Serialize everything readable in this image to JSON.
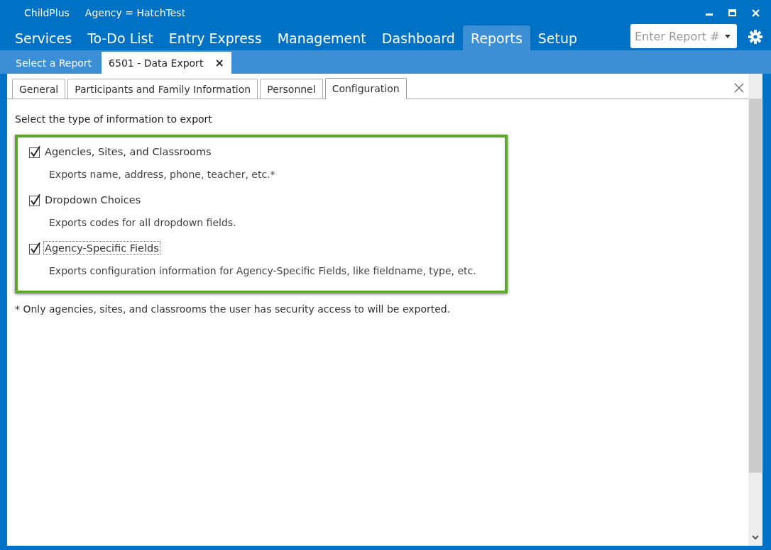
{
  "window": {
    "app_name": "ChildPlus",
    "agency": "Agency = HatchTest",
    "controls": [
      {
        "kind": "minimize"
      },
      {
        "kind": "maximize"
      },
      {
        "kind": "close"
      }
    ]
  },
  "menu": [
    {
      "label": "Services",
      "selected": false
    },
    {
      "label": "To-Do List",
      "selected": false
    },
    {
      "label": "Entry Express",
      "selected": false
    },
    {
      "label": "Management",
      "selected": false
    },
    {
      "label": "Dashboard",
      "selected": false
    },
    {
      "label": "Reports",
      "selected": true
    },
    {
      "label": "Setup",
      "selected": false
    }
  ],
  "report_search": {
    "placeholder": "Enter Report #"
  },
  "doc_tabs": [
    {
      "label": "Select a Report",
      "selected": false
    },
    {
      "label": "6501 - Data Export",
      "selected": true,
      "close_glyph": "×"
    }
  ],
  "sub_tabs": [
    {
      "label": "General",
      "selected": false
    },
    {
      "label": "Participants and Family Information",
      "selected": false
    },
    {
      "label": "Personnel",
      "selected": false
    },
    {
      "label": "Configuration",
      "selected": true
    }
  ],
  "heading": "Select the type of information to export",
  "options": [
    {
      "label": "Agencies, Sites, and Classrooms",
      "checked": true,
      "focused": false,
      "description": "Exports name, address, phone, teacher, etc.*"
    },
    {
      "label": "Dropdown Choices",
      "checked": true,
      "focused": false,
      "description": "Exports codes for all dropdown fields."
    },
    {
      "label": "Agency-Specific Fields",
      "checked": true,
      "focused": true,
      "description": "Exports configuration information for Agency-Specific Fields, like fieldname, type, etc."
    }
  ],
  "footnote": "* Only agencies, sites, and classrooms the user has security access to will be exported."
}
